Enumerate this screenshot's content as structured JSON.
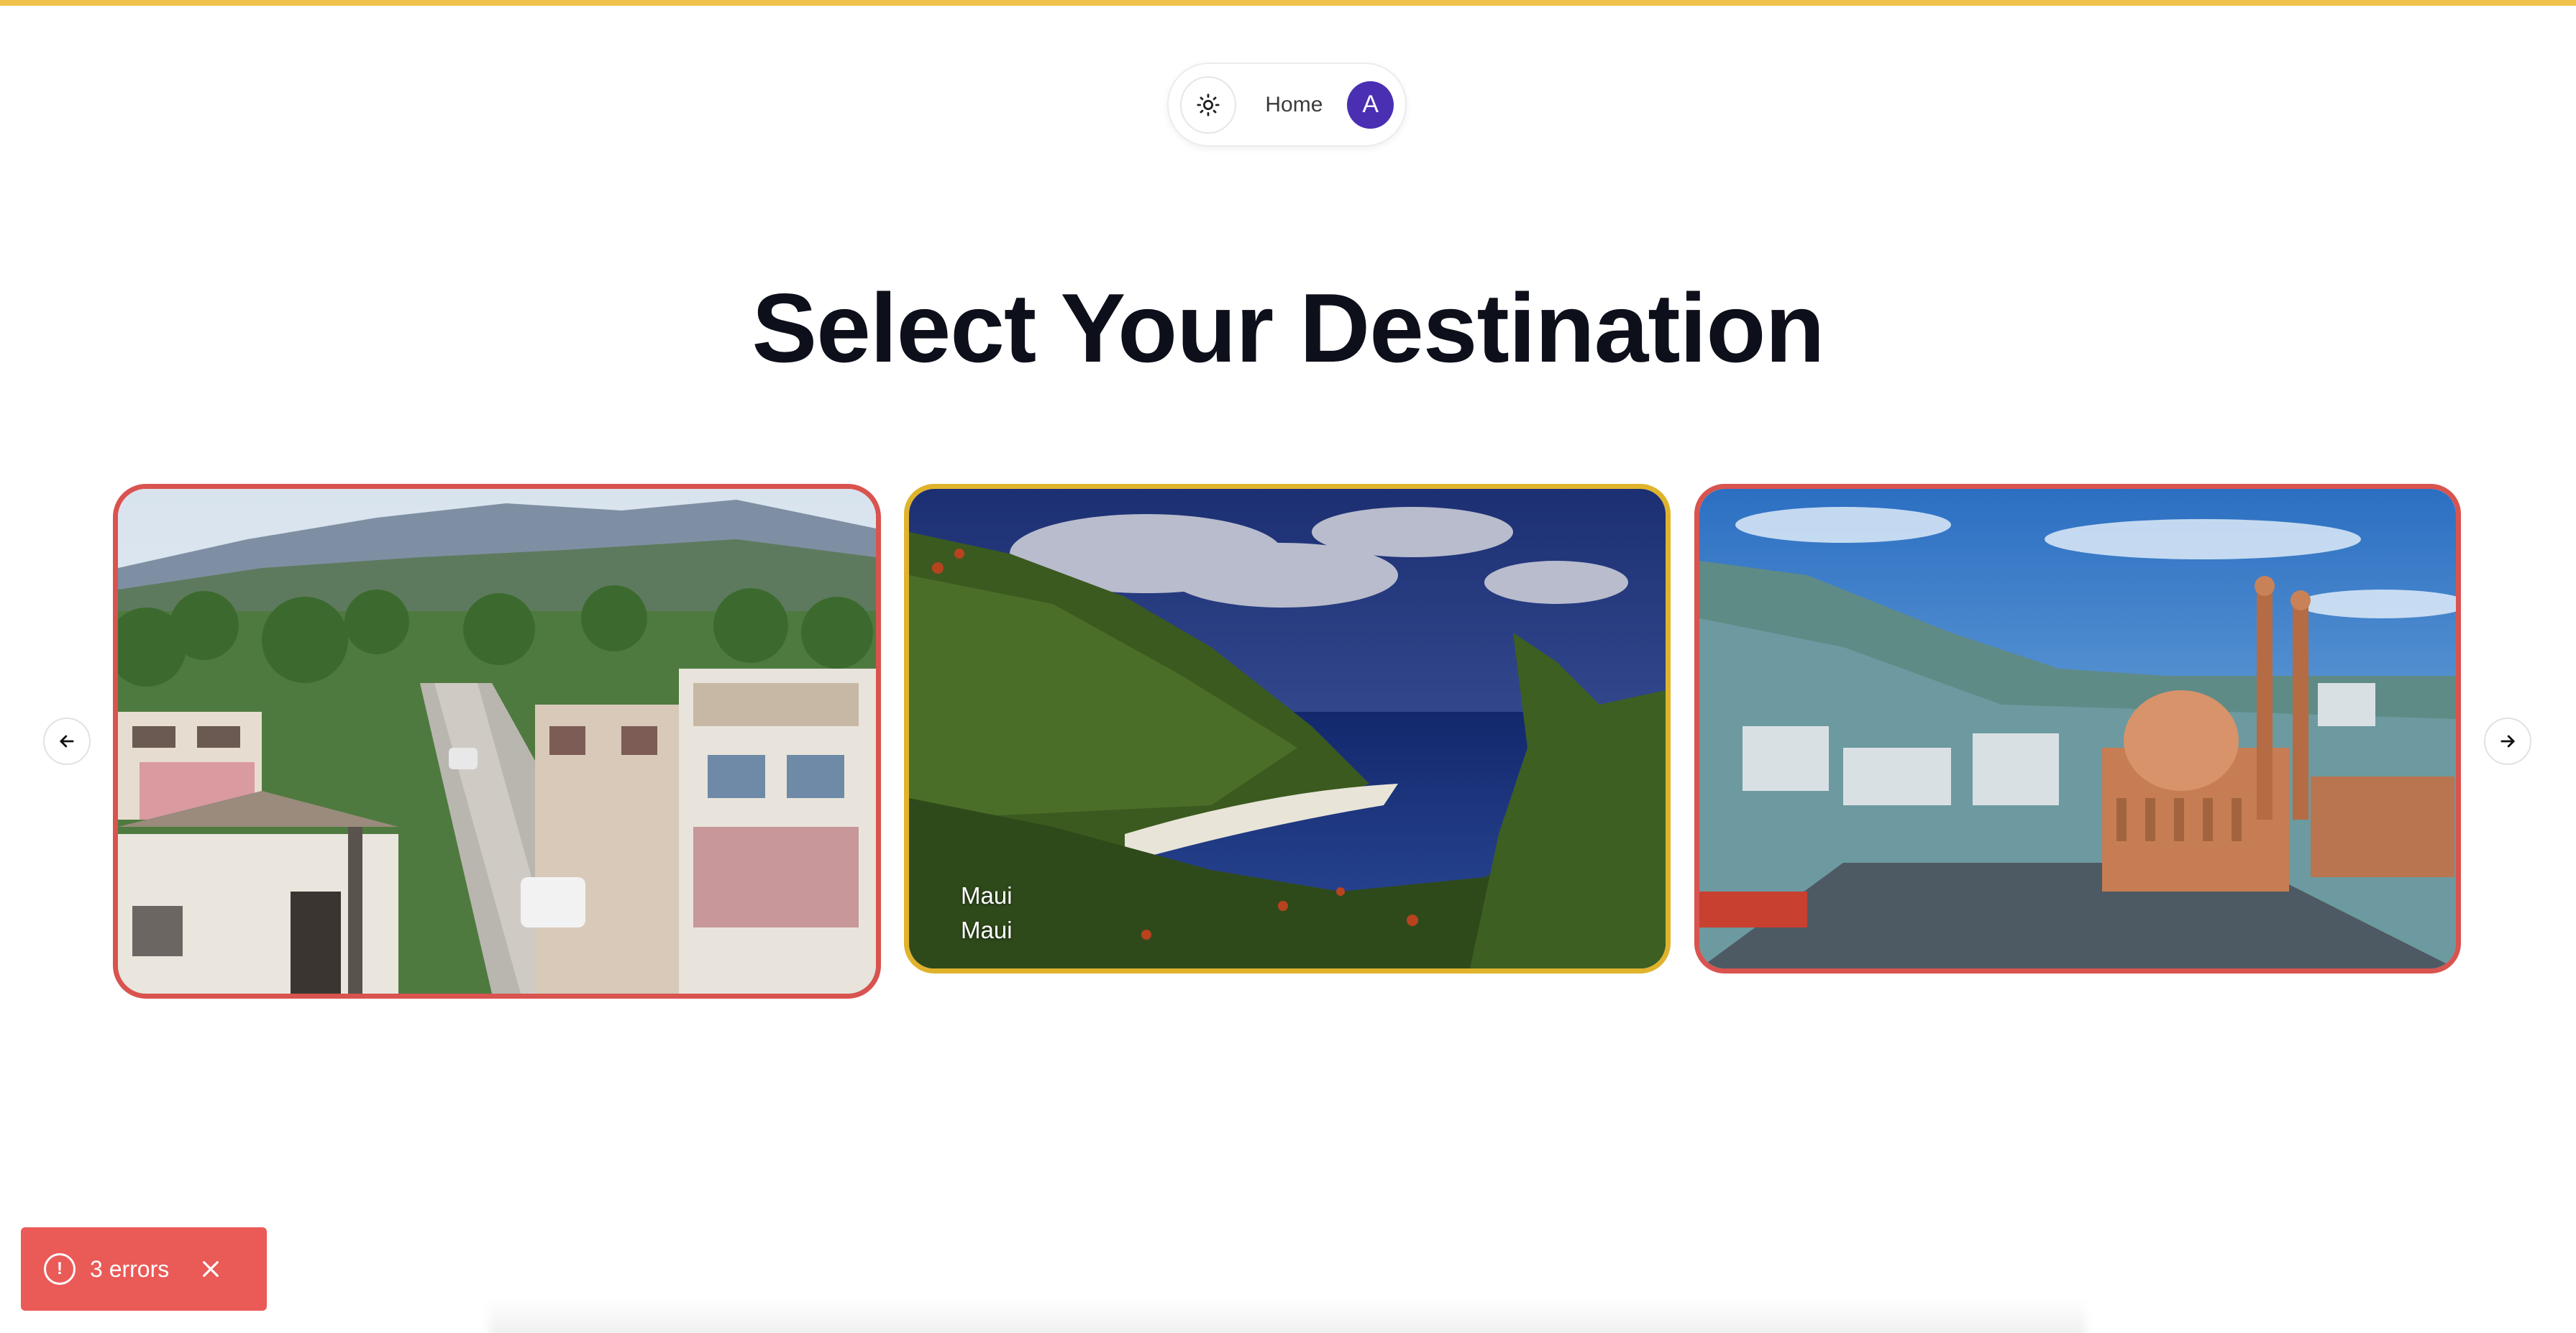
{
  "nav": {
    "theme_icon": "sun-icon",
    "home_label": "Home",
    "avatar_initial": "A"
  },
  "page": {
    "title": "Select Your Destination"
  },
  "carousel": {
    "prev_icon": "arrow-left-icon",
    "next_icon": "arrow-right-icon",
    "cards": [
      {
        "image": "hillside-town-street-photo",
        "border_color": "#d9534f"
      },
      {
        "image": "maui-coastline-photo",
        "border_color": "#e0b32c",
        "label_line1": "Maui",
        "label_line2": "Maui"
      },
      {
        "image": "city-mosque-photo",
        "border_color": "#d9534f"
      }
    ]
  },
  "toast": {
    "text": "3 errors",
    "icon": "alert-circle-icon",
    "close_icon": "close-icon",
    "color": "#ea5a57"
  },
  "colors": {
    "accent_bar": "#f0c24b",
    "avatar": "#4a2fb3",
    "title": "#0d0f1a"
  }
}
